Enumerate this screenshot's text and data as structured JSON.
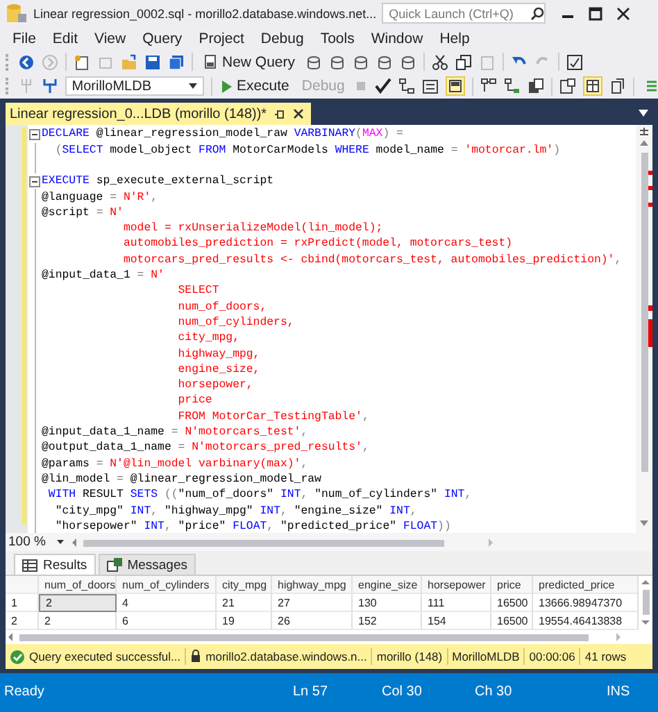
{
  "window": {
    "title": "Linear regression_0002.sql - morillo2.database.windows.net..."
  },
  "quick_launch": {
    "placeholder": "Quick Launch (Ctrl+Q)"
  },
  "menu": [
    "File",
    "Edit",
    "View",
    "Query",
    "Project",
    "Debug",
    "Tools",
    "Window",
    "Help"
  ],
  "toolbar": {
    "new_query": "New Query",
    "database": "MorilloMLDB",
    "execute": "Execute",
    "debug": {
      "label": "Debug",
      "disabled": true
    }
  },
  "document_tab": {
    "title": "Linear regression_0...LDB (morillo (148))*"
  },
  "editor": {
    "lines": [
      {
        "fold": true,
        "segs": [
          {
            "kind": "kw",
            "text": "DECLARE"
          },
          {
            "kind": "txt",
            "text": " @linear_regression_model_raw "
          },
          {
            "kind": "kw",
            "text": "VARBINARY"
          },
          {
            "kind": "op",
            "text": "("
          },
          {
            "kind": "fn",
            "text": "MAX"
          },
          {
            "kind": "op",
            "text": ") ="
          }
        ]
      },
      {
        "fold": false,
        "segs": [
          {
            "kind": "op",
            "text": "  ("
          },
          {
            "kind": "kw",
            "text": "SELECT"
          },
          {
            "kind": "txt",
            "text": " model_object "
          },
          {
            "kind": "kw",
            "text": "FROM"
          },
          {
            "kind": "txt",
            "text": " MotorCarModels "
          },
          {
            "kind": "kw",
            "text": "WHERE"
          },
          {
            "kind": "txt",
            "text": " model_name "
          },
          {
            "kind": "op",
            "text": "= "
          },
          {
            "kind": "str",
            "text": "'motorcar.lm'"
          },
          {
            "kind": "op",
            "text": ")"
          }
        ]
      },
      {
        "fold": false
      },
      {
        "fold": true,
        "segs": [
          {
            "kind": "kw",
            "text": "EXECUTE"
          },
          {
            "kind": "txt",
            "text": " sp_execute_external_script"
          }
        ]
      },
      {
        "fold": false,
        "segs": [
          {
            "kind": "txt",
            "text": "@language "
          },
          {
            "kind": "op",
            "text": "= "
          },
          {
            "kind": "str",
            "text": "N'R'"
          },
          {
            "kind": "op",
            "text": ","
          }
        ]
      },
      {
        "fold": false,
        "segs": [
          {
            "kind": "txt",
            "text": "@script "
          },
          {
            "kind": "op",
            "text": "= "
          },
          {
            "kind": "str",
            "text": "N'"
          }
        ]
      },
      {
        "fold": false,
        "segs": [
          {
            "kind": "str",
            "text": "            model = rxUnserializeModel(lin_model);"
          }
        ]
      },
      {
        "fold": false,
        "segs": [
          {
            "kind": "str",
            "text": "            automobiles_prediction = rxPredict(model, motorcars_test)"
          }
        ]
      },
      {
        "fold": false,
        "segs": [
          {
            "kind": "str",
            "text": "            motorcars_pred_results <- cbind(motorcars_test, automobiles_prediction)'"
          },
          {
            "kind": "op",
            "text": ","
          }
        ]
      },
      {
        "fold": false,
        "segs": [
          {
            "kind": "txt",
            "text": "@input_data_1 "
          },
          {
            "kind": "op",
            "text": "= "
          },
          {
            "kind": "str",
            "text": "N'"
          }
        ]
      },
      {
        "fold": false,
        "segs": [
          {
            "kind": "str",
            "text": "                    SELECT"
          }
        ]
      },
      {
        "fold": false,
        "segs": [
          {
            "kind": "str",
            "text": "                    num_of_doors,"
          }
        ]
      },
      {
        "fold": false,
        "segs": [
          {
            "kind": "str",
            "text": "                    num_of_cylinders,"
          }
        ]
      },
      {
        "fold": false,
        "segs": [
          {
            "kind": "str",
            "text": "                    city_mpg,"
          }
        ]
      },
      {
        "fold": false,
        "segs": [
          {
            "kind": "str",
            "text": "                    highway_mpg,"
          }
        ]
      },
      {
        "fold": false,
        "segs": [
          {
            "kind": "str",
            "text": "                    engine_size,"
          }
        ]
      },
      {
        "fold": false,
        "segs": [
          {
            "kind": "str",
            "text": "                    horsepower,"
          }
        ]
      },
      {
        "fold": false,
        "segs": [
          {
            "kind": "str",
            "text": "                    price"
          }
        ]
      },
      {
        "fold": false,
        "segs": [
          {
            "kind": "str",
            "text": "                    FROM MotorCar_TestingTable'"
          },
          {
            "kind": "op",
            "text": ","
          }
        ]
      },
      {
        "fold": false,
        "segs": [
          {
            "kind": "txt",
            "text": "@input_data_1_name "
          },
          {
            "kind": "op",
            "text": "= "
          },
          {
            "kind": "str",
            "text": "N'motorcars_test'"
          },
          {
            "kind": "op",
            "text": ","
          }
        ]
      },
      {
        "fold": false,
        "segs": [
          {
            "kind": "txt",
            "text": "@output_data_1_name "
          },
          {
            "kind": "op",
            "text": "= "
          },
          {
            "kind": "str",
            "text": "N'motorcars_pred_results'"
          },
          {
            "kind": "op",
            "text": ","
          }
        ]
      },
      {
        "fold": false,
        "segs": [
          {
            "kind": "txt",
            "text": "@params "
          },
          {
            "kind": "op",
            "text": "= "
          },
          {
            "kind": "str",
            "text": "N'@lin_model varbinary(max)'"
          },
          {
            "kind": "op",
            "text": ","
          }
        ]
      },
      {
        "fold": false,
        "segs": [
          {
            "kind": "txt",
            "text": "@lin_model "
          },
          {
            "kind": "op",
            "text": "= "
          },
          {
            "kind": "txt",
            "text": "@linear_regression_model_raw"
          }
        ]
      },
      {
        "fold": false,
        "segs": [
          {
            "kind": "kw",
            "text": " WITH"
          },
          {
            "kind": "txt",
            "text": " RESULT "
          },
          {
            "kind": "kw",
            "text": "SETS"
          },
          {
            "kind": "op",
            "text": " (("
          },
          {
            "kind": "txt",
            "text": "\"num_of_doors\" "
          },
          {
            "kind": "kw",
            "text": "INT"
          },
          {
            "kind": "op",
            "text": ", "
          },
          {
            "kind": "txt",
            "text": "\"num_of_cylinders\" "
          },
          {
            "kind": "kw",
            "text": "INT"
          },
          {
            "kind": "op",
            "text": ","
          }
        ]
      },
      {
        "fold": false,
        "segs": [
          {
            "kind": "txt",
            "text": "  \"city_mpg\" "
          },
          {
            "kind": "kw",
            "text": "INT"
          },
          {
            "kind": "op",
            "text": ", "
          },
          {
            "kind": "txt",
            "text": "\"highway_mpg\" "
          },
          {
            "kind": "kw",
            "text": "INT"
          },
          {
            "kind": "op",
            "text": ", "
          },
          {
            "kind": "txt",
            "text": "\"engine_size\" "
          },
          {
            "kind": "kw",
            "text": "INT"
          },
          {
            "kind": "op",
            "text": ","
          }
        ]
      },
      {
        "fold": false,
        "segs": [
          {
            "kind": "txt",
            "text": "  \"horsepower\" "
          },
          {
            "kind": "kw",
            "text": "INT"
          },
          {
            "kind": "op",
            "text": ", "
          },
          {
            "kind": "txt",
            "text": "\"price\" "
          },
          {
            "kind": "kw",
            "text": "FLOAT"
          },
          {
            "kind": "op",
            "text": ", "
          },
          {
            "kind": "txt",
            "text": "\"predicted_price\" "
          },
          {
            "kind": "kw",
            "text": "FLOAT"
          },
          {
            "kind": "op",
            "text": "))"
          }
        ]
      }
    ]
  },
  "zoom": "100 %",
  "results_tabs": [
    {
      "label": "Results",
      "selected": true
    },
    {
      "label": "Messages",
      "selected": false
    }
  ],
  "grid": {
    "columns": [
      "num_of_doors",
      "num_of_cylinders",
      "city_mpg",
      "highway_mpg",
      "engine_size",
      "horsepower",
      "price",
      "predicted_price"
    ],
    "rows": [
      {
        "number": "1",
        "cells": [
          {
            "text": "2",
            "selected": true
          },
          {
            "text": "4",
            "selected": false
          },
          {
            "text": "21",
            "selected": false
          },
          {
            "text": "27",
            "selected": false
          },
          {
            "text": "130",
            "selected": false
          },
          {
            "text": "111",
            "selected": false
          },
          {
            "text": "16500",
            "selected": false
          },
          {
            "text": "13666.98947370",
            "selected": false
          }
        ]
      },
      {
        "number": "2",
        "cells": [
          {
            "text": "2",
            "selected": false
          },
          {
            "text": "6",
            "selected": false
          },
          {
            "text": "19",
            "selected": false
          },
          {
            "text": "26",
            "selected": false
          },
          {
            "text": "152",
            "selected": false
          },
          {
            "text": "154",
            "selected": false
          },
          {
            "text": "16500",
            "selected": false
          },
          {
            "text": "19554.46413838",
            "selected": false
          }
        ]
      }
    ]
  },
  "query_status": {
    "message": "Query executed successful...",
    "server": "morillo2.database.windows.n...",
    "login": "morillo (148)",
    "database": "MorilloMLDB",
    "elapsed": "00:00:06",
    "rows": "41 rows"
  },
  "status_bar": {
    "state": "Ready",
    "line": "Ln 57",
    "column": "Col 30",
    "char": "Ch 30",
    "mode": "INS"
  }
}
